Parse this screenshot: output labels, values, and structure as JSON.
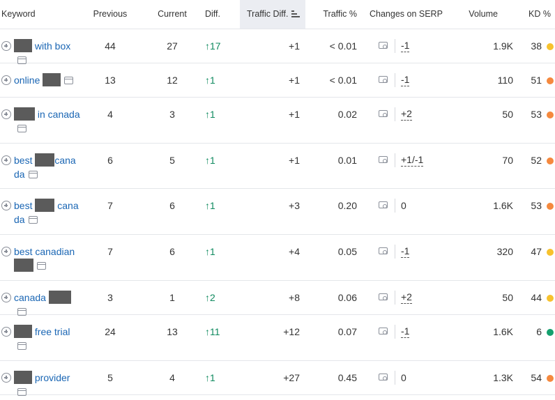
{
  "columns": {
    "keyword": "Keyword",
    "previous": "Previous",
    "current": "Current",
    "diff": "Diff.",
    "traffic_diff": "Traffic Diff.",
    "traffic_pct": "Traffic %",
    "changes_serp": "Changes on SERP",
    "volume": "Volume",
    "kd": "KD %"
  },
  "colors": {
    "link": "#1a66b4",
    "positive": "#0f8a5f",
    "kd_yellow": "#f7c22d",
    "kd_orange": "#f5893e",
    "kd_green": "#14a06e",
    "redaction": "#5b5b5b"
  },
  "rows": [
    {
      "kw_parts": [
        {
          "mask": 26
        },
        {
          "text": " with box"
        }
      ],
      "previous": "44",
      "current": "27",
      "diff": "↑17",
      "traffic_diff": "+1",
      "traffic_pct": "< 0.01",
      "serp": "-1",
      "serp_dashed": true,
      "volume": "1.9K",
      "kd": "38",
      "kd_color": "kd_yellow"
    },
    {
      "kw_parts": [
        {
          "text": "online "
        },
        {
          "mask": 26
        }
      ],
      "previous": "13",
      "current": "12",
      "diff": "↑1",
      "traffic_diff": "+1",
      "traffic_pct": "< 0.01",
      "serp": "-1",
      "serp_dashed": true,
      "volume": "110",
      "kd": "51",
      "kd_color": "kd_orange"
    },
    {
      "kw_parts": [
        {
          "mask": 30
        },
        {
          "text": " in canada"
        }
      ],
      "previous": "4",
      "current": "3",
      "diff": "↑1",
      "traffic_diff": "+1",
      "traffic_pct": "0.02",
      "serp": "+2",
      "serp_dashed": true,
      "volume": "50",
      "kd": "53",
      "kd_color": "kd_orange"
    },
    {
      "kw_parts": [
        {
          "text": "best "
        },
        {
          "mask": 28
        },
        {
          "text": "canada"
        }
      ],
      "previous": "6",
      "current": "5",
      "diff": "↑1",
      "traffic_diff": "+1",
      "traffic_pct": "0.01",
      "serp": "+1/-1",
      "serp_dashed": true,
      "volume": "70",
      "kd": "52",
      "kd_color": "kd_orange"
    },
    {
      "kw_parts": [
        {
          "text": "best "
        },
        {
          "mask": 28
        },
        {
          "text": " canada"
        }
      ],
      "previous": "7",
      "current": "6",
      "diff": "↑1",
      "traffic_diff": "+3",
      "traffic_pct": "0.20",
      "serp": "0",
      "serp_dashed": false,
      "volume": "1.6K",
      "kd": "53",
      "kd_color": "kd_orange"
    },
    {
      "kw_parts": [
        {
          "text": "best canadian "
        },
        {
          "mask": 28
        }
      ],
      "previous": "7",
      "current": "6",
      "diff": "↑1",
      "traffic_diff": "+4",
      "traffic_pct": "0.05",
      "serp": "-1",
      "serp_dashed": true,
      "volume": "320",
      "kd": "47",
      "kd_color": "kd_yellow"
    },
    {
      "kw_parts": [
        {
          "text": "canada "
        },
        {
          "mask": 32
        }
      ],
      "previous": "3",
      "current": "1",
      "diff": "↑2",
      "traffic_diff": "+8",
      "traffic_pct": "0.06",
      "serp": "+2",
      "serp_dashed": true,
      "volume": "50",
      "kd": "44",
      "kd_color": "kd_yellow"
    },
    {
      "kw_parts": [
        {
          "mask": 26
        },
        {
          "text": " free trial"
        }
      ],
      "previous": "24",
      "current": "13",
      "diff": "↑11",
      "traffic_diff": "+12",
      "traffic_pct": "0.07",
      "serp": "-1",
      "serp_dashed": true,
      "volume": "1.6K",
      "kd": "6",
      "kd_color": "kd_green"
    },
    {
      "kw_parts": [
        {
          "mask": 26
        },
        {
          "text": " provider"
        }
      ],
      "previous": "5",
      "current": "4",
      "diff": "↑1",
      "traffic_diff": "+27",
      "traffic_pct": "0.45",
      "serp": "0",
      "serp_dashed": false,
      "volume": "1.3K",
      "kd": "54",
      "kd_color": "kd_orange"
    }
  ]
}
